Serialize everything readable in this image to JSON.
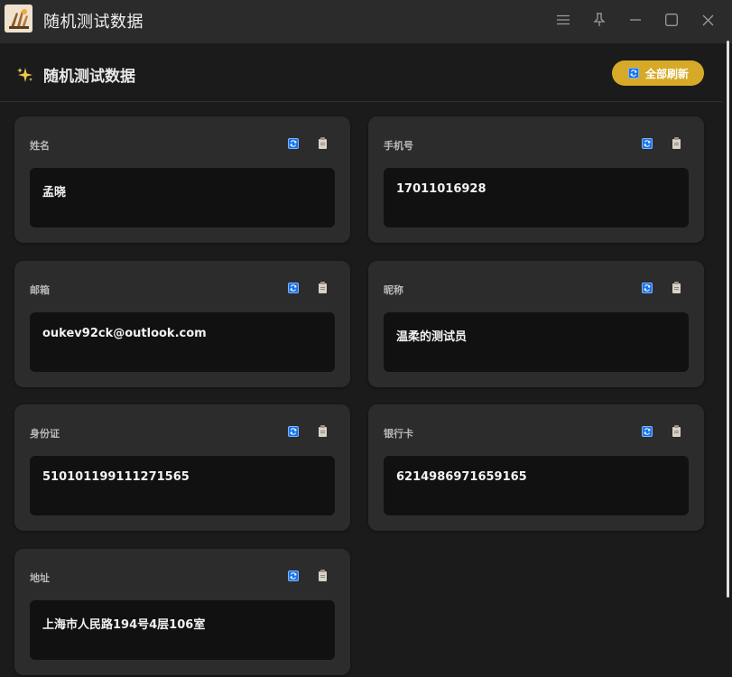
{
  "window": {
    "title": "随机测试数据",
    "buttons": [
      "menu-icon",
      "pin-icon",
      "minimize-icon",
      "maximize-icon",
      "close-icon"
    ]
  },
  "header": {
    "icon": "sparkles-icon",
    "title": "随机测试数据",
    "refresh_all_label": "全部刷新",
    "accent_color": "#d6aa28"
  },
  "cards": [
    {
      "label": "姓名",
      "value": "孟晓"
    },
    {
      "label": "手机号",
      "value": "17011016928"
    },
    {
      "label": "邮箱",
      "value": "oukev92ck@outlook.com"
    },
    {
      "label": "昵称",
      "value": "温柔的测试员"
    },
    {
      "label": "身份证",
      "value": "510101199111271565"
    },
    {
      "label": "银行卡",
      "value": "6214986971659165"
    },
    {
      "label": "地址",
      "value": "上海市人民路194号4层106室"
    }
  ]
}
